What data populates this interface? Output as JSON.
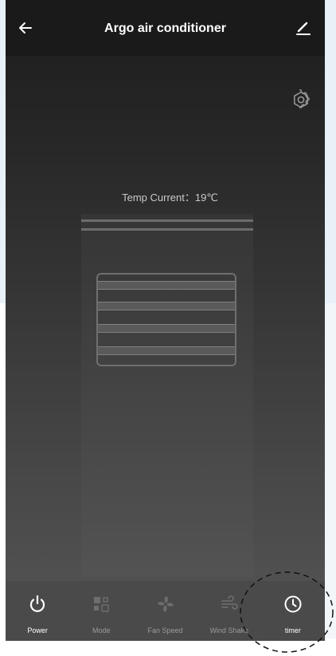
{
  "header": {
    "title": "Argo air conditioner",
    "back_icon": "arrow-left-icon",
    "edit_icon": "pencil-icon"
  },
  "settings_icon": "gear-icon",
  "status": {
    "temp_current": "Temp Current：19℃"
  },
  "controls": [
    {
      "label": "Power",
      "icon": "power-icon",
      "active": true
    },
    {
      "label": "Mode",
      "icon": "mode-icon",
      "active": false
    },
    {
      "label": "Fan Speed",
      "icon": "fan-icon",
      "active": false
    },
    {
      "label": "Wind Shake",
      "icon": "wind-icon",
      "active": false
    },
    {
      "label": "timer",
      "icon": "clock-icon",
      "active": true
    }
  ],
  "colors": {
    "header_bg": "#1a1a1a",
    "bottom_bar_bg": "#4a4a4a",
    "active": "#ffffff",
    "inactive": "#9a9a9a"
  }
}
